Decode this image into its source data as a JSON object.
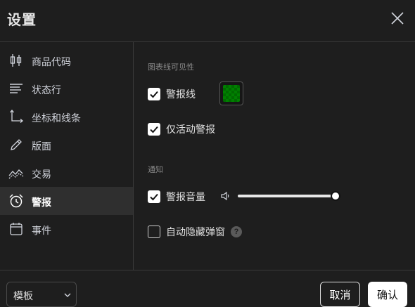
{
  "dialog": {
    "title": "设置"
  },
  "sidebar": {
    "items": [
      {
        "label": "商品代码",
        "icon": "candlestick-icon"
      },
      {
        "label": "状态行",
        "icon": "status-lines-icon"
      },
      {
        "label": "坐标和线条",
        "icon": "axes-icon"
      },
      {
        "label": "版面",
        "icon": "pencil-icon"
      },
      {
        "label": "交易",
        "icon": "trading-icon"
      },
      {
        "label": "警报",
        "icon": "alarm-clock-icon",
        "active": true
      },
      {
        "label": "事件",
        "icon": "calendar-icon"
      }
    ]
  },
  "content": {
    "chart_visibility": {
      "title": "图表线可见性",
      "alert_line": {
        "label": "警报线",
        "checked": true,
        "color": "#008000"
      },
      "active_only": {
        "label": "仅活动警报",
        "checked": true
      }
    },
    "notifications": {
      "title": "通知",
      "alert_volume": {
        "label": "警报音量",
        "checked": true,
        "volume_fraction": 1.0
      },
      "auto_hide_popup": {
        "label": "自动隐藏弹窗",
        "checked": false,
        "help_glyph": "?"
      }
    }
  },
  "footer": {
    "template_label": "模板",
    "cancel_label": "取消",
    "ok_label": "确认"
  },
  "colors": {
    "background": "#1e1e1e",
    "active_item_bg": "#2f2f2f",
    "divider": "#3a3a3a",
    "accent_green": "#008000"
  }
}
